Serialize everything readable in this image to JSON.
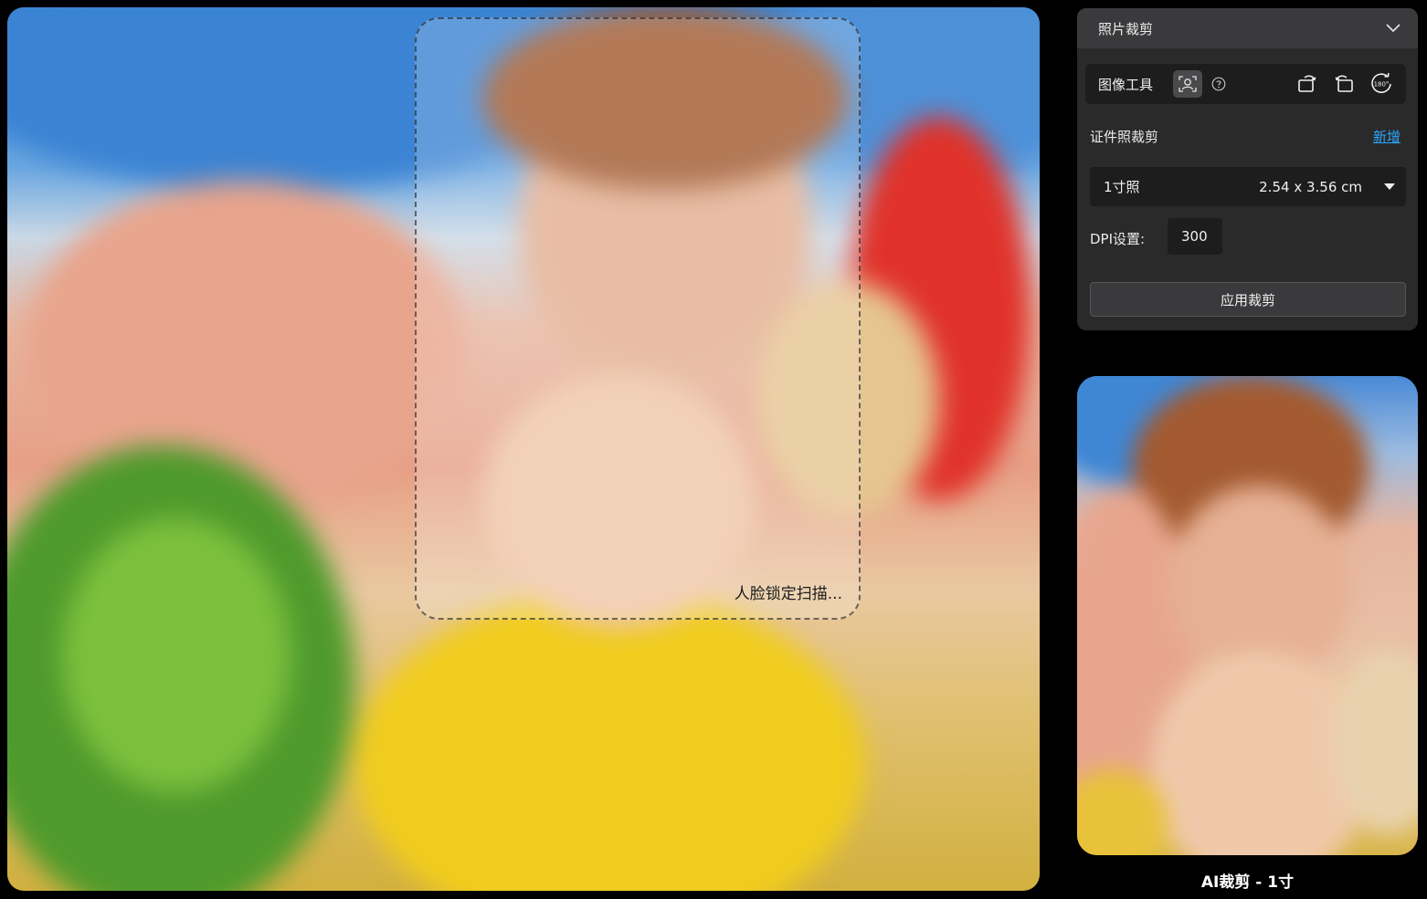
{
  "canvas": {
    "scan_status": "人脸锁定扫描..."
  },
  "panel": {
    "title": "照片裁剪",
    "tools": {
      "label": "图像工具",
      "icons": [
        "face-portrait-icon",
        "help-icon",
        "rotate-left-icon",
        "rotate-right-icon",
        "rotate-180-icon"
      ],
      "rotate_180_text": "180°"
    },
    "id_crop": {
      "label": "证件照裁剪",
      "add_label": "新增"
    },
    "size_select": {
      "name": "1寸照",
      "dimensions": "2.54 x 3.56 cm"
    },
    "dpi": {
      "label": "DPI设置:",
      "value": "300"
    },
    "apply_label": "应用裁剪"
  },
  "preview": {
    "caption": "AI裁剪 - 1寸"
  },
  "colors": {
    "panel_bg": "#2a2a2b",
    "header_bg": "#3a3a3c",
    "field_bg": "#1d1d1e",
    "link": "#2aa6ff"
  }
}
